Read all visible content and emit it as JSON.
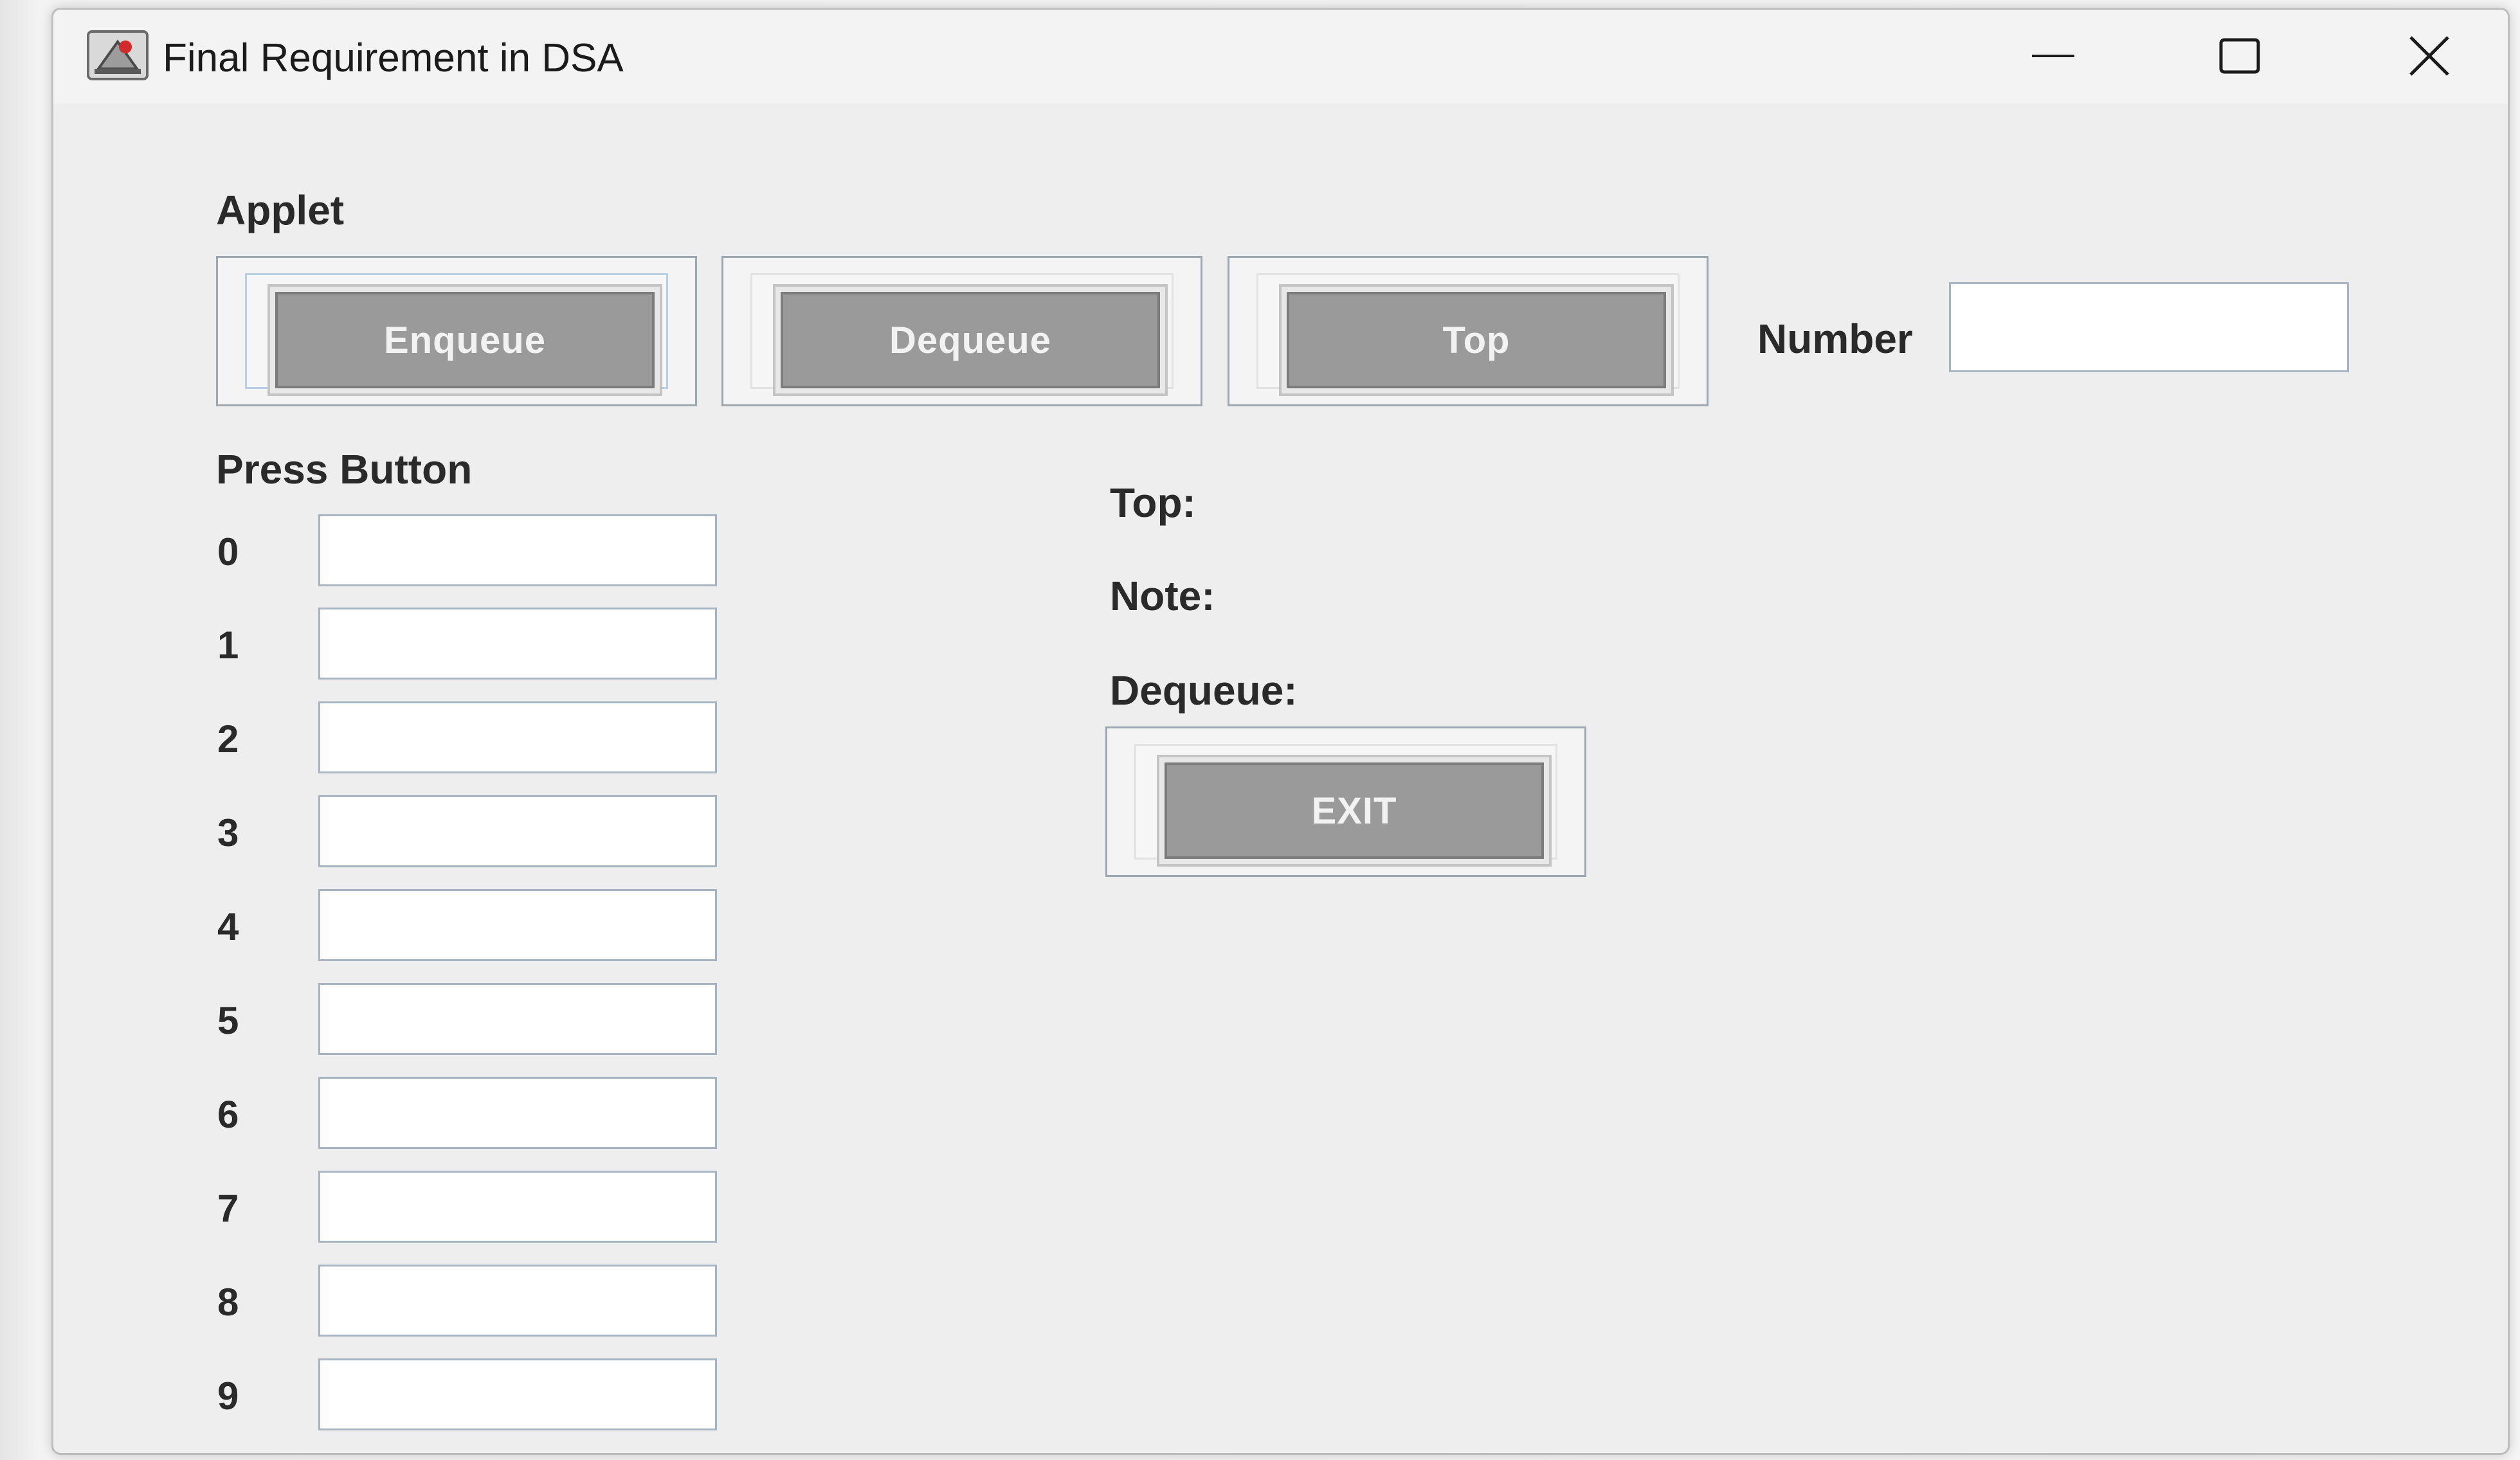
{
  "window": {
    "title": "Final Requirement in DSA",
    "app_icon": "java-applet-icon",
    "controls": [
      "minimize-icon",
      "maximize-icon",
      "close-icon"
    ]
  },
  "applet": {
    "section_label": "Applet",
    "buttons": {
      "enqueue": "Enqueue",
      "dequeue": "Dequeue",
      "top": "Top",
      "exit": "EXIT"
    },
    "number_label": "Number",
    "number_value": "",
    "press_label": "Press Button",
    "status": {
      "top_label": "Top:",
      "note_label": "Note:",
      "dequeue_label": "Dequeue:"
    },
    "queue_slots": [
      {
        "index": "0",
        "value": ""
      },
      {
        "index": "1",
        "value": ""
      },
      {
        "index": "2",
        "value": ""
      },
      {
        "index": "3",
        "value": ""
      },
      {
        "index": "4",
        "value": ""
      },
      {
        "index": "5",
        "value": ""
      },
      {
        "index": "6",
        "value": ""
      },
      {
        "index": "7",
        "value": ""
      },
      {
        "index": "8",
        "value": ""
      },
      {
        "index": "9",
        "value": ""
      }
    ]
  },
  "colors": {
    "window_bg": "#eeeeee",
    "button_face": "#9a9a9a",
    "button_text": "#f2f2f2",
    "label_text": "#2a2a2a"
  }
}
